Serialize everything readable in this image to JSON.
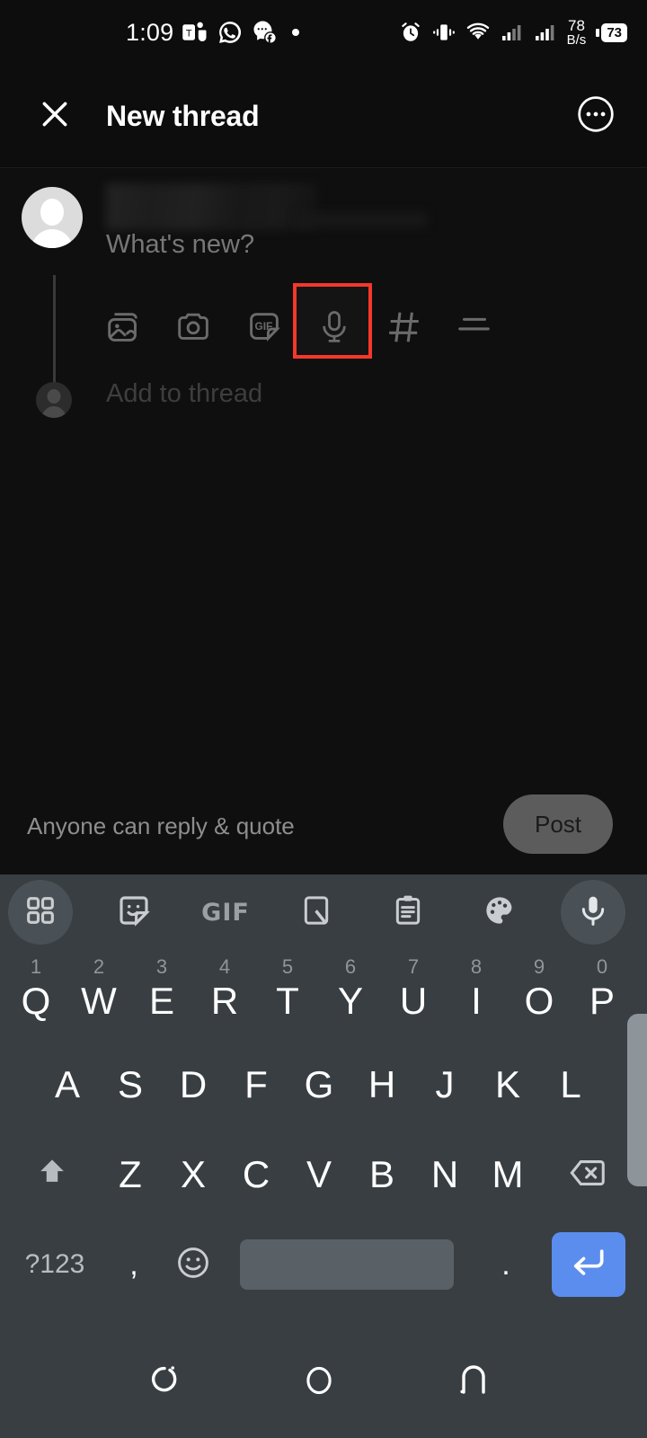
{
  "status_bar": {
    "time": "1:09",
    "left_icons": [
      "teams-icon",
      "whatsapp-icon",
      "messenger-icon",
      "dot-indicator"
    ],
    "alarm_icon": "alarm-icon",
    "vibrate_icon": "vibrate-icon",
    "wifi_icon": "wifi-icon",
    "signal_icons": [
      "signal-bars-sim1-icon",
      "signal-bars-sim2-icon"
    ],
    "network_speed_value": "78",
    "network_speed_unit": "B/s",
    "battery_level": "73"
  },
  "app_bar": {
    "close_label": "close-icon",
    "title": "New thread",
    "more_label": "more-options-icon"
  },
  "composer": {
    "avatar": "user-avatar",
    "username_blurred": "",
    "placeholder": "What's new?",
    "attachment_icons": [
      {
        "name": "gallery-icon",
        "label": "Gallery"
      },
      {
        "name": "camera-icon",
        "label": "Camera"
      },
      {
        "name": "gif-icon",
        "label": "GIF"
      },
      {
        "name": "microphone-icon",
        "label": "Voice"
      },
      {
        "name": "hashtag-icon",
        "label": "Tag"
      },
      {
        "name": "poll-icon",
        "label": "Poll"
      }
    ],
    "highlighted_icon": "microphone-icon",
    "highlight_color": "#f4382a",
    "add_to_thread_label": "Add to thread"
  },
  "reply_bar": {
    "audience_text": "Anyone can reply & quote",
    "post_label": "Post"
  },
  "keyboard": {
    "toolbar": [
      {
        "name": "apps-grid-icon",
        "label": "Apps"
      },
      {
        "name": "sticker-icon",
        "label": "Stickers"
      },
      {
        "name": "gif-icon",
        "label": "GIF"
      },
      {
        "name": "handwriting-icon",
        "label": "Handwriting"
      },
      {
        "name": "clipboard-icon",
        "label": "Clipboard"
      },
      {
        "name": "theme-palette-icon",
        "label": "Themes"
      },
      {
        "name": "voice-input-icon",
        "label": "Voice input"
      }
    ],
    "row1": [
      {
        "letter": "Q",
        "num": "1"
      },
      {
        "letter": "W",
        "num": "2"
      },
      {
        "letter": "E",
        "num": "3"
      },
      {
        "letter": "R",
        "num": "4"
      },
      {
        "letter": "T",
        "num": "5"
      },
      {
        "letter": "Y",
        "num": "6"
      },
      {
        "letter": "U",
        "num": "7"
      },
      {
        "letter": "I",
        "num": "8"
      },
      {
        "letter": "O",
        "num": "9"
      },
      {
        "letter": "P",
        "num": "0"
      }
    ],
    "row2": [
      "A",
      "S",
      "D",
      "F",
      "G",
      "H",
      "J",
      "K",
      "L"
    ],
    "row3": [
      "Z",
      "X",
      "C",
      "V",
      "B",
      "N",
      "M"
    ],
    "shift_key": "shift-icon",
    "backspace_key": "backspace-icon",
    "symbols_key": "?123",
    "comma_key": ",",
    "emoji_key": "emoji-icon",
    "space_key": "",
    "period_key": ".",
    "enter_key": "enter-icon",
    "accent_color": "#5b8dee"
  },
  "nav_bar": {
    "recents": "recents-icon",
    "home": "home-icon",
    "back": "back-icon"
  }
}
